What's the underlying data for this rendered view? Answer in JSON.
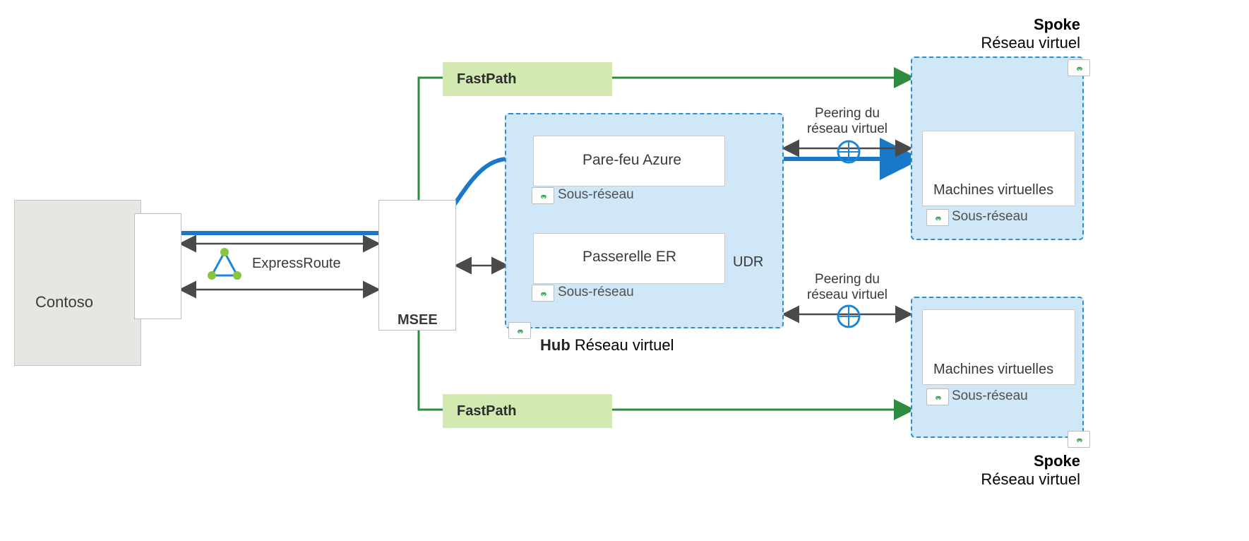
{
  "on_prem": {
    "name": "Contoso"
  },
  "connection": {
    "type": "ExpressRoute",
    "edge_label": "MSEE"
  },
  "fastpath": {
    "label": "FastPath"
  },
  "hub": {
    "title_bold": "Hub",
    "title_rest": "Réseau virtuel",
    "firewall": {
      "label": "Pare-feu Azure",
      "subnet": "Sous-réseau"
    },
    "gateway": {
      "label": "Passerelle ER",
      "subnet": "Sous-réseau",
      "udr": "UDR"
    }
  },
  "peering": {
    "label_line1": "Peering du",
    "label_line2": "réseau virtuel"
  },
  "spoke_top": {
    "title_bold": "Spoke",
    "title_rest": "Réseau virtuel",
    "vms": "Machines virtuelles",
    "subnet": "Sous-réseau"
  },
  "spoke_bottom": {
    "title_bold": "Spoke",
    "title_rest": "Réseau virtuel",
    "vms": "Machines virtuelles",
    "subnet": "Sous-réseau"
  },
  "colors": {
    "fastpath_line": "#2e8b3f",
    "expressroute_line": "#1978c8",
    "arrow_gray": "#4a4a4a",
    "azure_blue": "#1b87d6",
    "azure_light": "#d0e7f7"
  }
}
